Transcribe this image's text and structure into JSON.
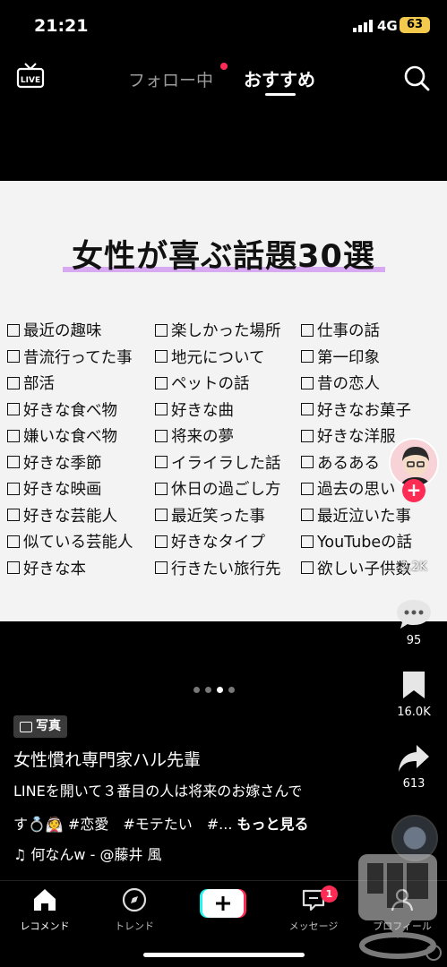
{
  "status_bar": {
    "time": "21:21",
    "network": "4G",
    "battery": "63"
  },
  "top_nav": {
    "live": "LIVE",
    "following": "フォロー中",
    "for_you": "おすすめ"
  },
  "card": {
    "title": "女性が喜ぶ話題30選",
    "columns": [
      [
        "最近の趣味",
        "昔流行ってた事",
        "部活",
        "好きな食べ物",
        "嫌いな食べ物",
        "好きな季節",
        "好きな映画",
        "好きな芸能人",
        "似ている芸能人",
        "好きな本"
      ],
      [
        "楽しかった場所",
        "地元について",
        "ペットの話",
        "好きな曲",
        "将来の夢",
        "イライラした話",
        "休日の過ごし方",
        "最近笑った事",
        "好きなタイプ",
        "行きたい旅行先"
      ],
      [
        "仕事の話",
        "第一印象",
        "昔の恋人",
        "好きなお菓子",
        "好きな洋服",
        "あるある",
        "過去の思い",
        "最近泣いた事",
        "YouTubeの話",
        "欲しい子供数"
      ]
    ]
  },
  "actions": {
    "likes": "2.2K",
    "comments": "95",
    "bookmarks": "16.0K",
    "shares": "613"
  },
  "post": {
    "badge": "写真",
    "author": "女性慣れ専門家ハル先輩",
    "caption_line1": "LINEを開いて３番目の人は将来のお嫁さんで",
    "caption_line2": "す💍👰 #恋愛　#モテたい　#... ",
    "more": "もっと見る",
    "music": "♫ 何なんw - @藤井 風"
  },
  "bottom_nav": {
    "home": "レコメンド",
    "trend": "トレンド",
    "messages": "メッセージ",
    "messages_badge": "1",
    "profile": "プロフィール"
  },
  "colors": {
    "accent": "#fe2c55",
    "title_underline": "#d7a9f0"
  }
}
